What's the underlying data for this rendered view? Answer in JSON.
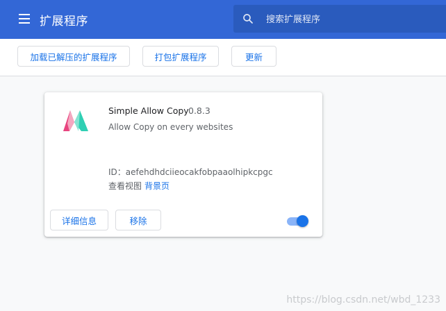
{
  "header": {
    "title": "扩展程序",
    "search_placeholder": "搜索扩展程序",
    "background_color": "#3367d6"
  },
  "toolbar": {
    "load_unpacked_label": "加载已解压的扩展程序",
    "pack_label": "打包扩展程序",
    "update_label": "更新"
  },
  "extension": {
    "name": "Simple Allow Copy",
    "version": "0.8.3",
    "description": "Allow Copy on every websites",
    "id_text": "ID：aefehdhdciieocakfobpaaolhipkcpgc",
    "views_label": "查看视图",
    "views_link": "背景页",
    "details_label": "详细信息",
    "remove_label": "移除",
    "enabled": true,
    "logo_icon": "allow-copy-logo-icon"
  },
  "watermark": "https://blog.csdn.net/wbd_1233",
  "colors": {
    "accent": "#1a73e8",
    "toggle_track": "#8ab4f8"
  }
}
